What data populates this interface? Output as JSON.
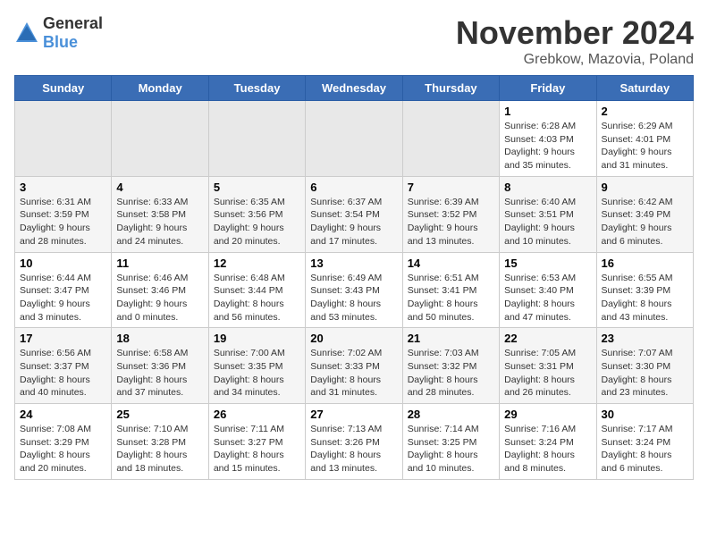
{
  "logo": {
    "text_general": "General",
    "text_blue": "Blue"
  },
  "title": {
    "month": "November 2024",
    "location": "Grebkow, Mazovia, Poland"
  },
  "days_of_week": [
    "Sunday",
    "Monday",
    "Tuesday",
    "Wednesday",
    "Thursday",
    "Friday",
    "Saturday"
  ],
  "weeks": [
    [
      {
        "day": "",
        "info": ""
      },
      {
        "day": "",
        "info": ""
      },
      {
        "day": "",
        "info": ""
      },
      {
        "day": "",
        "info": ""
      },
      {
        "day": "",
        "info": ""
      },
      {
        "day": "1",
        "info": "Sunrise: 6:28 AM\nSunset: 4:03 PM\nDaylight: 9 hours and 35 minutes."
      },
      {
        "day": "2",
        "info": "Sunrise: 6:29 AM\nSunset: 4:01 PM\nDaylight: 9 hours and 31 minutes."
      }
    ],
    [
      {
        "day": "3",
        "info": "Sunrise: 6:31 AM\nSunset: 3:59 PM\nDaylight: 9 hours and 28 minutes."
      },
      {
        "day": "4",
        "info": "Sunrise: 6:33 AM\nSunset: 3:58 PM\nDaylight: 9 hours and 24 minutes."
      },
      {
        "day": "5",
        "info": "Sunrise: 6:35 AM\nSunset: 3:56 PM\nDaylight: 9 hours and 20 minutes."
      },
      {
        "day": "6",
        "info": "Sunrise: 6:37 AM\nSunset: 3:54 PM\nDaylight: 9 hours and 17 minutes."
      },
      {
        "day": "7",
        "info": "Sunrise: 6:39 AM\nSunset: 3:52 PM\nDaylight: 9 hours and 13 minutes."
      },
      {
        "day": "8",
        "info": "Sunrise: 6:40 AM\nSunset: 3:51 PM\nDaylight: 9 hours and 10 minutes."
      },
      {
        "day": "9",
        "info": "Sunrise: 6:42 AM\nSunset: 3:49 PM\nDaylight: 9 hours and 6 minutes."
      }
    ],
    [
      {
        "day": "10",
        "info": "Sunrise: 6:44 AM\nSunset: 3:47 PM\nDaylight: 9 hours and 3 minutes."
      },
      {
        "day": "11",
        "info": "Sunrise: 6:46 AM\nSunset: 3:46 PM\nDaylight: 9 hours and 0 minutes."
      },
      {
        "day": "12",
        "info": "Sunrise: 6:48 AM\nSunset: 3:44 PM\nDaylight: 8 hours and 56 minutes."
      },
      {
        "day": "13",
        "info": "Sunrise: 6:49 AM\nSunset: 3:43 PM\nDaylight: 8 hours and 53 minutes."
      },
      {
        "day": "14",
        "info": "Sunrise: 6:51 AM\nSunset: 3:41 PM\nDaylight: 8 hours and 50 minutes."
      },
      {
        "day": "15",
        "info": "Sunrise: 6:53 AM\nSunset: 3:40 PM\nDaylight: 8 hours and 47 minutes."
      },
      {
        "day": "16",
        "info": "Sunrise: 6:55 AM\nSunset: 3:39 PM\nDaylight: 8 hours and 43 minutes."
      }
    ],
    [
      {
        "day": "17",
        "info": "Sunrise: 6:56 AM\nSunset: 3:37 PM\nDaylight: 8 hours and 40 minutes."
      },
      {
        "day": "18",
        "info": "Sunrise: 6:58 AM\nSunset: 3:36 PM\nDaylight: 8 hours and 37 minutes."
      },
      {
        "day": "19",
        "info": "Sunrise: 7:00 AM\nSunset: 3:35 PM\nDaylight: 8 hours and 34 minutes."
      },
      {
        "day": "20",
        "info": "Sunrise: 7:02 AM\nSunset: 3:33 PM\nDaylight: 8 hours and 31 minutes."
      },
      {
        "day": "21",
        "info": "Sunrise: 7:03 AM\nSunset: 3:32 PM\nDaylight: 8 hours and 28 minutes."
      },
      {
        "day": "22",
        "info": "Sunrise: 7:05 AM\nSunset: 3:31 PM\nDaylight: 8 hours and 26 minutes."
      },
      {
        "day": "23",
        "info": "Sunrise: 7:07 AM\nSunset: 3:30 PM\nDaylight: 8 hours and 23 minutes."
      }
    ],
    [
      {
        "day": "24",
        "info": "Sunrise: 7:08 AM\nSunset: 3:29 PM\nDaylight: 8 hours and 20 minutes."
      },
      {
        "day": "25",
        "info": "Sunrise: 7:10 AM\nSunset: 3:28 PM\nDaylight: 8 hours and 18 minutes."
      },
      {
        "day": "26",
        "info": "Sunrise: 7:11 AM\nSunset: 3:27 PM\nDaylight: 8 hours and 15 minutes."
      },
      {
        "day": "27",
        "info": "Sunrise: 7:13 AM\nSunset: 3:26 PM\nDaylight: 8 hours and 13 minutes."
      },
      {
        "day": "28",
        "info": "Sunrise: 7:14 AM\nSunset: 3:25 PM\nDaylight: 8 hours and 10 minutes."
      },
      {
        "day": "29",
        "info": "Sunrise: 7:16 AM\nSunset: 3:24 PM\nDaylight: 8 hours and 8 minutes."
      },
      {
        "day": "30",
        "info": "Sunrise: 7:17 AM\nSunset: 3:24 PM\nDaylight: 8 hours and 6 minutes."
      }
    ]
  ]
}
